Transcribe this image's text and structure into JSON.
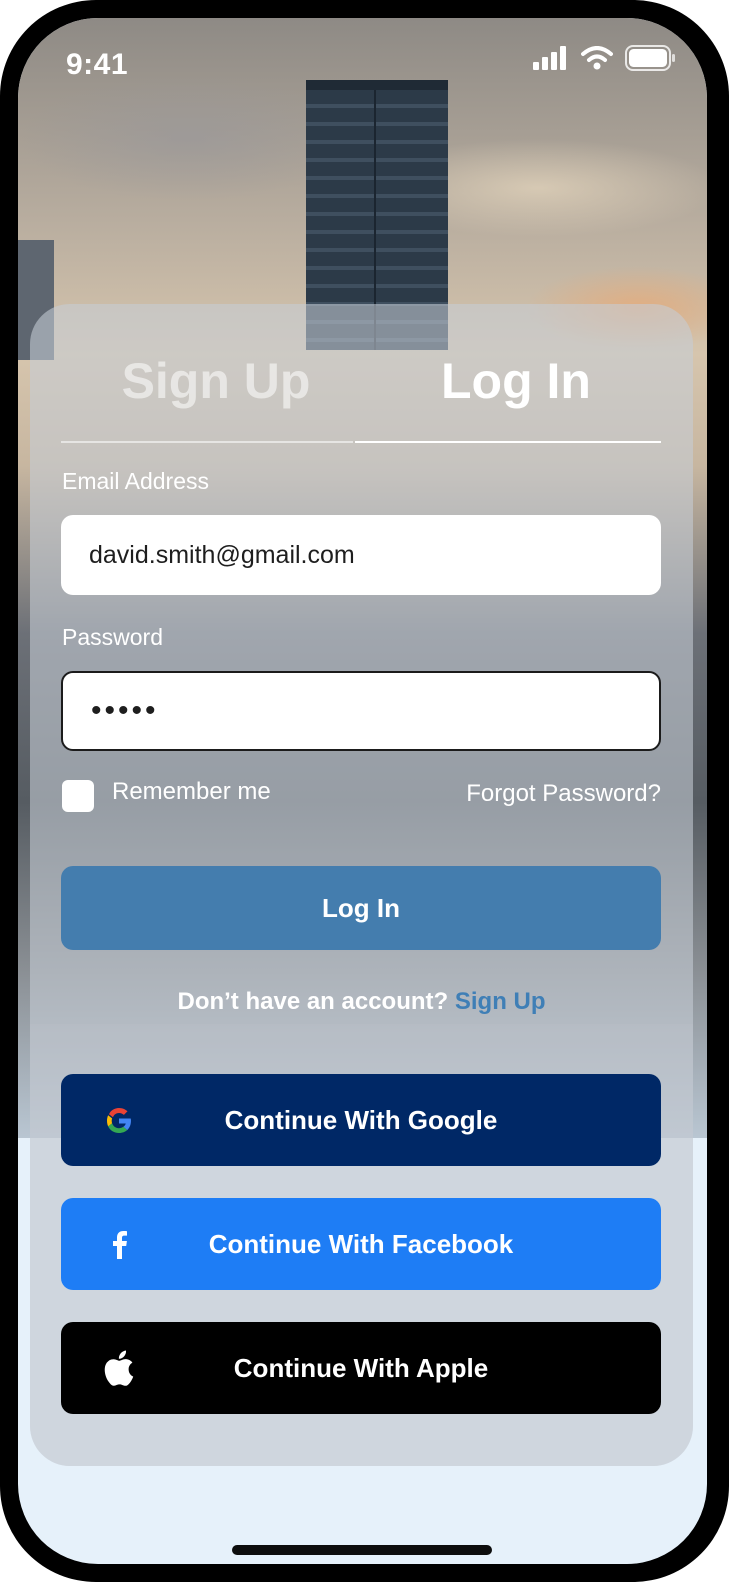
{
  "status_bar": {
    "time": "9:41",
    "signal_icon": "cellular-signal-icon",
    "wifi_icon": "wifi-icon",
    "battery_icon": "battery-icon"
  },
  "tabs": {
    "signup": "Sign Up",
    "login": "Log In",
    "active": "login"
  },
  "form": {
    "email_label": "Email Address",
    "email_value": "david.smith@gmail.com",
    "password_label": "Password",
    "password_value": "•••••",
    "remember_label": "Remember me",
    "remember_checked": false,
    "forgot_label": "Forgot Password?",
    "submit_label": "Log In"
  },
  "signup_prompt": {
    "text": "Don’t have an account?",
    "link": "Sign Up"
  },
  "social": {
    "google": {
      "label": "Continue With Google",
      "icon": "google-icon"
    },
    "facebook": {
      "label": "Continue With Facebook",
      "icon": "facebook-icon"
    },
    "apple": {
      "label": "Continue With Apple",
      "icon": "apple-icon"
    }
  },
  "colors": {
    "primary_button": "#447dae",
    "google_button": "#002866",
    "facebook_button": "#1e7df5",
    "apple_button": "#000000",
    "link": "#3f7fb6"
  }
}
